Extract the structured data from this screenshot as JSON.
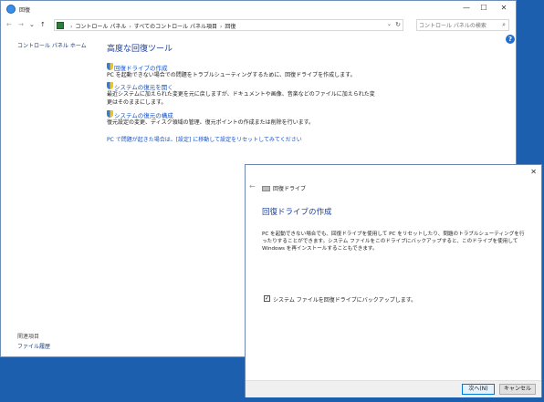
{
  "window": {
    "title": "回復",
    "minimize": "—",
    "maximize": "☐",
    "close": "✕"
  },
  "nav": {
    "back": "←",
    "forward": "→",
    "recent": "⌄",
    "up": "↑"
  },
  "address": {
    "crumbs": [
      "コントロール パネル",
      "すべてのコントロール パネル項目",
      "回復"
    ],
    "separator": "›",
    "dropdown": "⌄",
    "refresh": "↻"
  },
  "search": {
    "placeholder": "コントロール パネルの検索",
    "icon": "⌕"
  },
  "help": "?",
  "sidebar": {
    "home": "コントロール パネル ホーム",
    "related_heading": "関連項目",
    "related_link": "ファイル履歴"
  },
  "content": {
    "title": "高度な回復ツール",
    "tools": [
      {
        "label": "回復ドライブの作成",
        "description": "PC を起動できない場合での問題をトラブルシューティングするために、回復ドライブを作成します。"
      },
      {
        "label": "システムの復元を開く",
        "description": "最近システムに加えられた変更を元に戻しますが、ドキュメントや画像、音楽などのファイルに加えられた変更はそのままにします。"
      },
      {
        "label": "システムの復元の構成",
        "description": "復元設定の変更、ディスク領域の管理、復元ポイントの作成または削除を行います。"
      }
    ],
    "reset_link": "PC で問題が起きた場合は、[設定] に移動して設定をリセットしてみてください"
  },
  "dialog": {
    "close": "✕",
    "back": "←",
    "title": "回復ドライブ",
    "heading": "回復ドライブの作成",
    "body": "PC を起動できない場合でも、回復ドライブを使用して PC をリセットしたり、問題のトラブルシューティングを行ったりすることができます。システム ファイルをこのドライブにバックアップすると、このドライブを使用して Windows を再インストールすることもできます。",
    "checkbox_label": "システム ファイルを回復ドライブにバックアップします。",
    "checkbox_mark": "✓",
    "checkbox_checked": true,
    "next_button": "次へ(N)",
    "cancel_button": "キャンセル"
  }
}
